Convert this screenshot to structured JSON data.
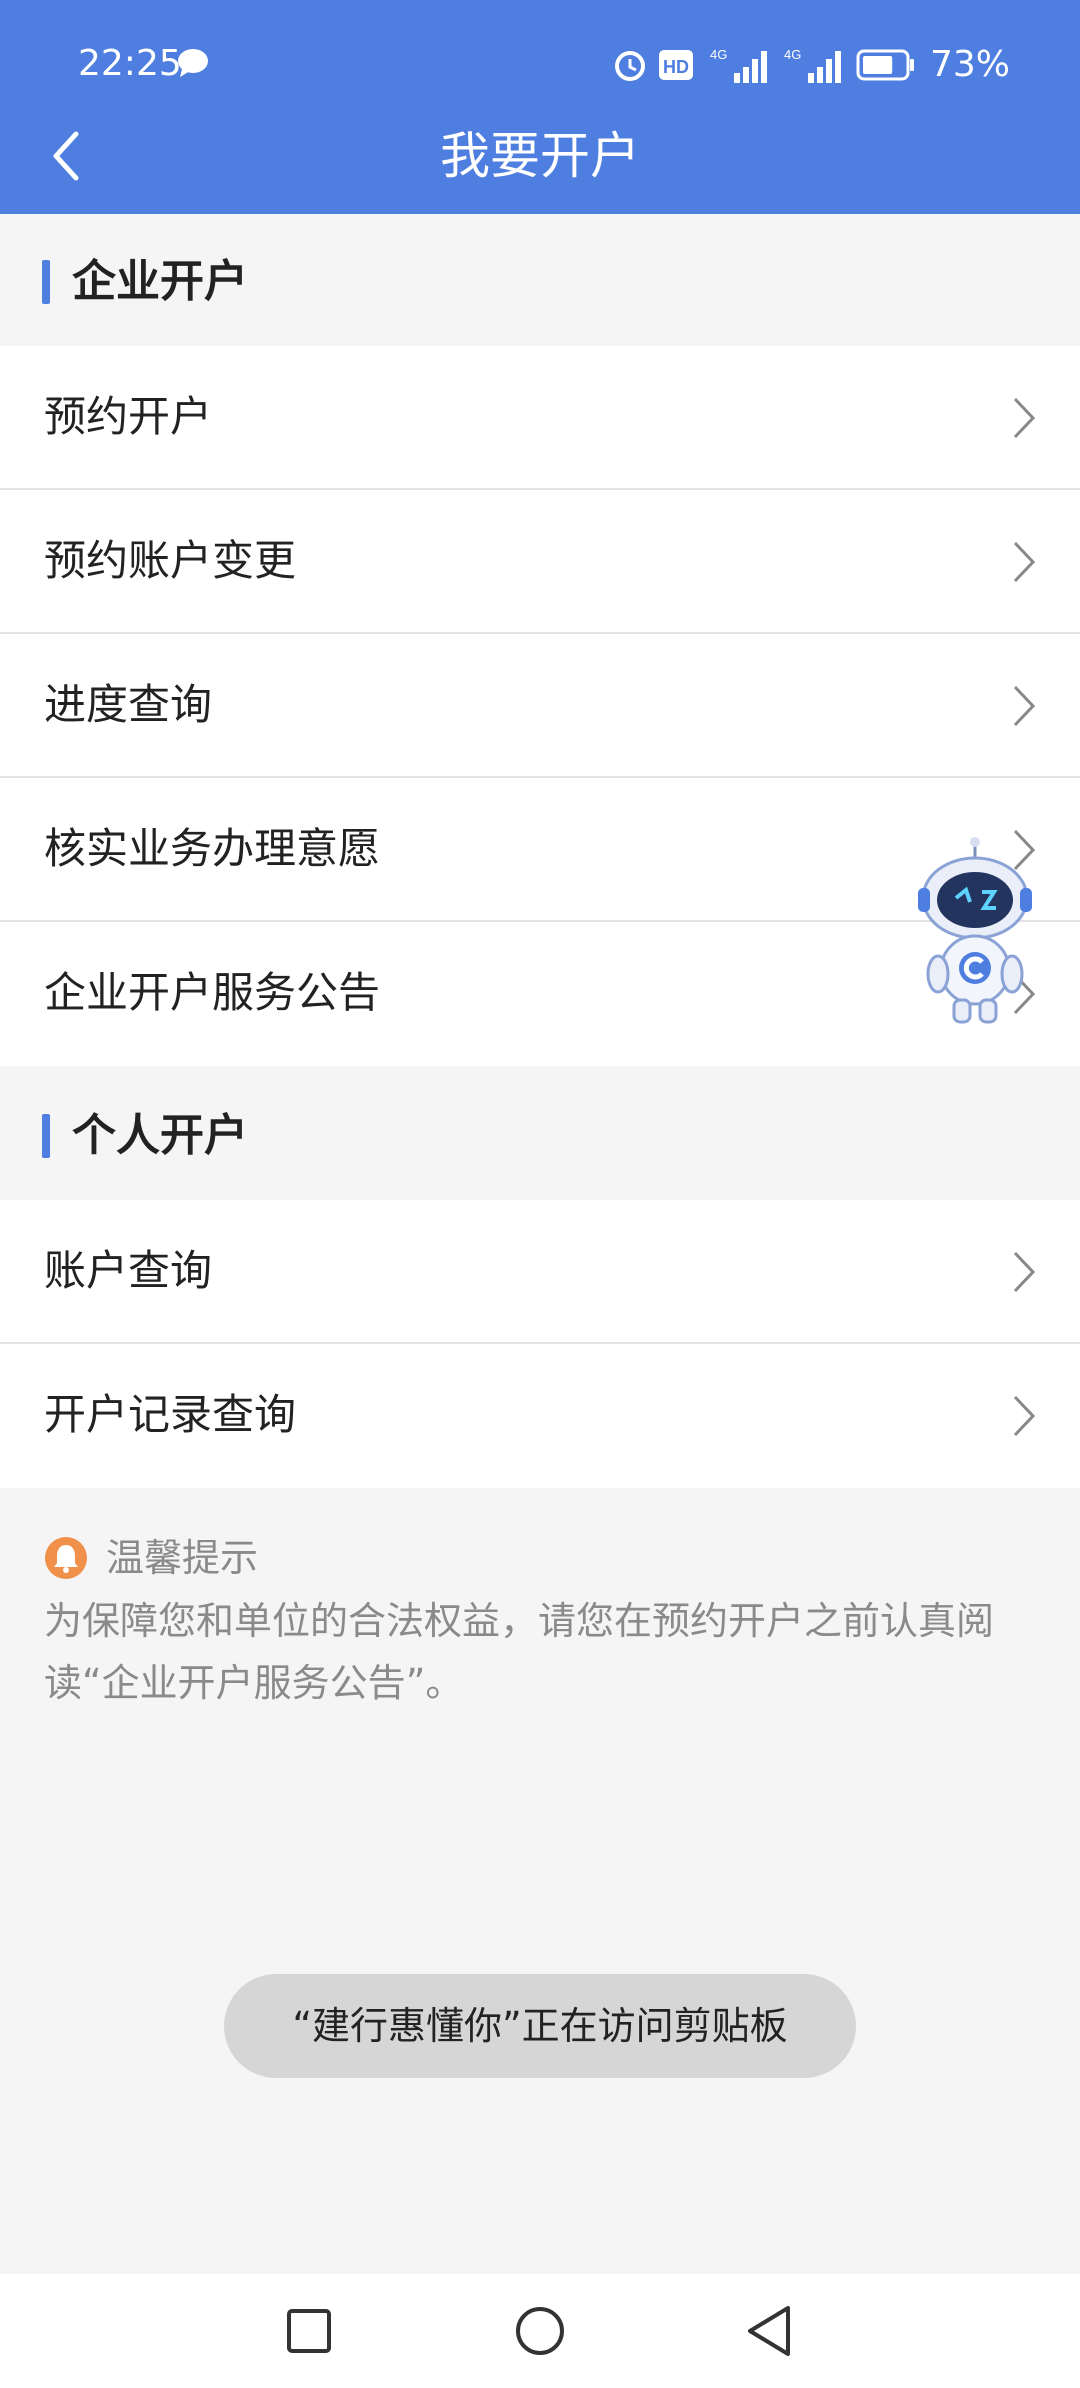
{
  "status_bar": {
    "time": "22:25",
    "hd_label": "HD",
    "network_label": "4G",
    "battery_percent": "73%",
    "battery_level": 0.73,
    "icons": [
      "message-icon",
      "alarm-icon",
      "hd-icon",
      "signal-icon",
      "signal-icon",
      "battery-icon"
    ]
  },
  "header": {
    "title": "我要开户",
    "color": "#4e7ee0"
  },
  "sections": [
    {
      "title": "企业开户",
      "items": [
        "预约开户",
        "预约账户变更",
        "进度查询",
        "核实业务办理意愿",
        "企业开户服务公告"
      ]
    },
    {
      "title": "个人开户",
      "items": [
        "账户查询",
        "开户记录查询"
      ]
    }
  ],
  "tips": {
    "title": "温馨提示",
    "text": "为保障您和单位的合法权益，请您在预约开户之前认真阅读“企业开户服务公告”。"
  },
  "toast": {
    "text": "“建行惠懂你”正在访问剪贴板"
  },
  "nav": [
    "recent-apps-icon",
    "home-icon",
    "back-icon"
  ],
  "colors": {
    "accent": "#4e7ee0",
    "tip_icon": "#f0904a",
    "text_primary": "#222222",
    "text_secondary": "#8a8a8a"
  }
}
